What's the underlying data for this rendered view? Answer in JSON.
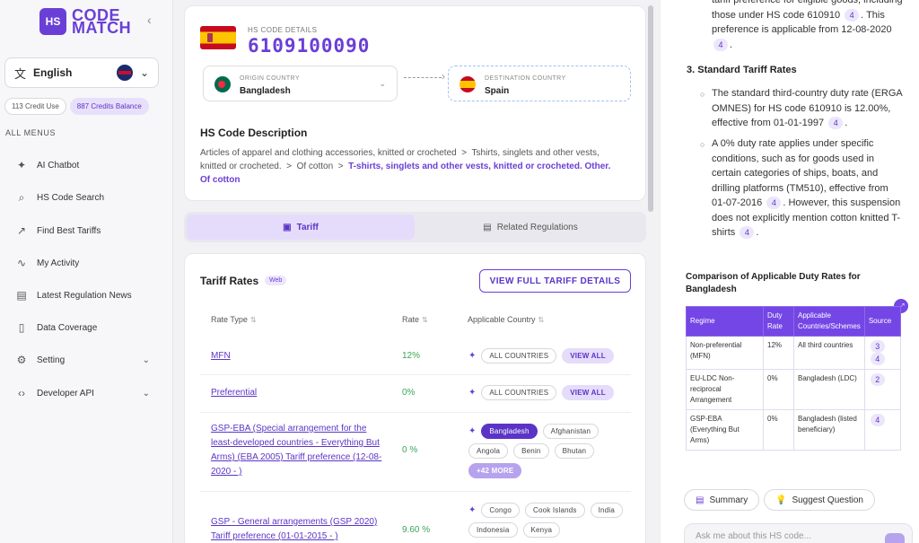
{
  "brand": {
    "badge": "HS",
    "line1": "CODE",
    "line2": "MATCH"
  },
  "sidebar": {
    "collapse_icon": "chevron-left-icon",
    "language": "English",
    "credit_use": "113 Credit Use",
    "credits_balance": "887 Credits Balance",
    "menus_title": "ALL MENUS",
    "items": [
      {
        "label": "AI Chatbot",
        "icon": "sparkle-icon"
      },
      {
        "label": "HS Code Search",
        "icon": "search-icon"
      },
      {
        "label": "Find Best Tariffs",
        "icon": "trend-icon"
      },
      {
        "label": "My Activity",
        "icon": "activity-icon"
      },
      {
        "label": "Latest Regulation News",
        "icon": "news-icon"
      },
      {
        "label": "Data Coverage",
        "icon": "document-icon"
      },
      {
        "label": "Setting",
        "icon": "gear-icon"
      },
      {
        "label": "Developer API",
        "icon": "code-icon"
      }
    ]
  },
  "hs": {
    "label": "HS CODE DETAILS",
    "code": "6109100090",
    "origin_label": "ORIGIN COUNTRY",
    "origin": "Bangladesh",
    "dest_label": "DESTINATION COUNTRY",
    "dest": "Spain",
    "desc_title": "HS Code Description",
    "desc_1": "Articles of apparel and clothing accessories, knitted or crocheted",
    "desc_2": "Tshirts, singlets and other vests, knitted or crocheted.",
    "desc_3": "Of cotton",
    "desc_4": "T-shirts, singlets and other vests, knitted or crocheted. Other. Of cotton"
  },
  "tabs": {
    "tariff": "Tariff",
    "related": "Related Regulations"
  },
  "tariff": {
    "title": "Tariff Rates",
    "web": "Web",
    "view_full": "VIEW FULL TARIFF DETAILS",
    "col_type": "Rate Type",
    "col_rate": "Rate",
    "col_country": "Applicable Country",
    "rows": [
      {
        "type": "MFN",
        "rate": "12%",
        "c1": "ALL COUNTRIES",
        "c2": "VIEW ALL"
      },
      {
        "type": "Preferential",
        "rate": "0%",
        "c1": "ALL COUNTRIES",
        "c2": "VIEW ALL"
      },
      {
        "type": "GSP-EBA (Special arrangement for the least-developed countries - Everything But Arms) (EBA 2005) Tariff preference (12-08-2020 - )",
        "rate": "0 %",
        "c1": "Bangladesh",
        "c2": "Afghanistan",
        "c3": "Angola",
        "c4": "Benin",
        "c5": "Bhutan",
        "c6": "+42 MORE"
      },
      {
        "type": "GSP - General arrangements (GSP 2020) Tariff preference (01-01-2015 - )",
        "rate": "9.60 %",
        "c1": "Congo",
        "c2": "Cook Islands",
        "c3": "India",
        "c4": "Indonesia",
        "c5": "Kenya"
      }
    ]
  },
  "panel": {
    "p1_a": "tariff preference for eligible goods, including those under HS code 610910",
    "p1_ref1": "4",
    "p1_b": ". This preference is applicable from 12-08-2020",
    "p1_ref2": "4",
    "p1_c": ".",
    "h3": "3. Standard Tariff Rates",
    "b1_a": "The standard third-country duty rate (ERGA OMNES) for HS code 610910 is 12.00%, effective from 01-01-1997",
    "b1_ref": "4",
    "b1_c": ".",
    "b2_a": "A 0% duty rate applies under specific conditions, such as for goods used in certain categories of ships, boats, and drilling platforms (TM510), effective from 01-07-2016",
    "b2_ref1": "4",
    "b2_b": ". However, this suspension does not explicitly mention cotton knitted T-shirts",
    "b2_ref2": "4",
    "b2_c": ".",
    "cmp_title": "Comparison of Applicable Duty Rates for Bangladesh",
    "cmp_headers": [
      "Regime",
      "Duty Rate",
      "Applicable Countries/Schemes",
      "Source"
    ],
    "cmp_rows": [
      {
        "regime": "Non-preferential (MFN)",
        "rate": "12%",
        "countries": "All third countries",
        "src1": "3",
        "src2": "4"
      },
      {
        "regime": "EU-LDC Non-reciprocal Arrangement",
        "rate": "0%",
        "countries": "Bangladesh (LDC)",
        "src1": "2"
      },
      {
        "regime": "GSP-EBA (Everything But Arms)",
        "rate": "0%",
        "countries": "Bangladesh (listed beneficiary)",
        "src1": "4"
      }
    ],
    "summary": "Summary",
    "suggest": "Suggest Question",
    "ask_placeholder": "Ask me about this HS code..."
  }
}
